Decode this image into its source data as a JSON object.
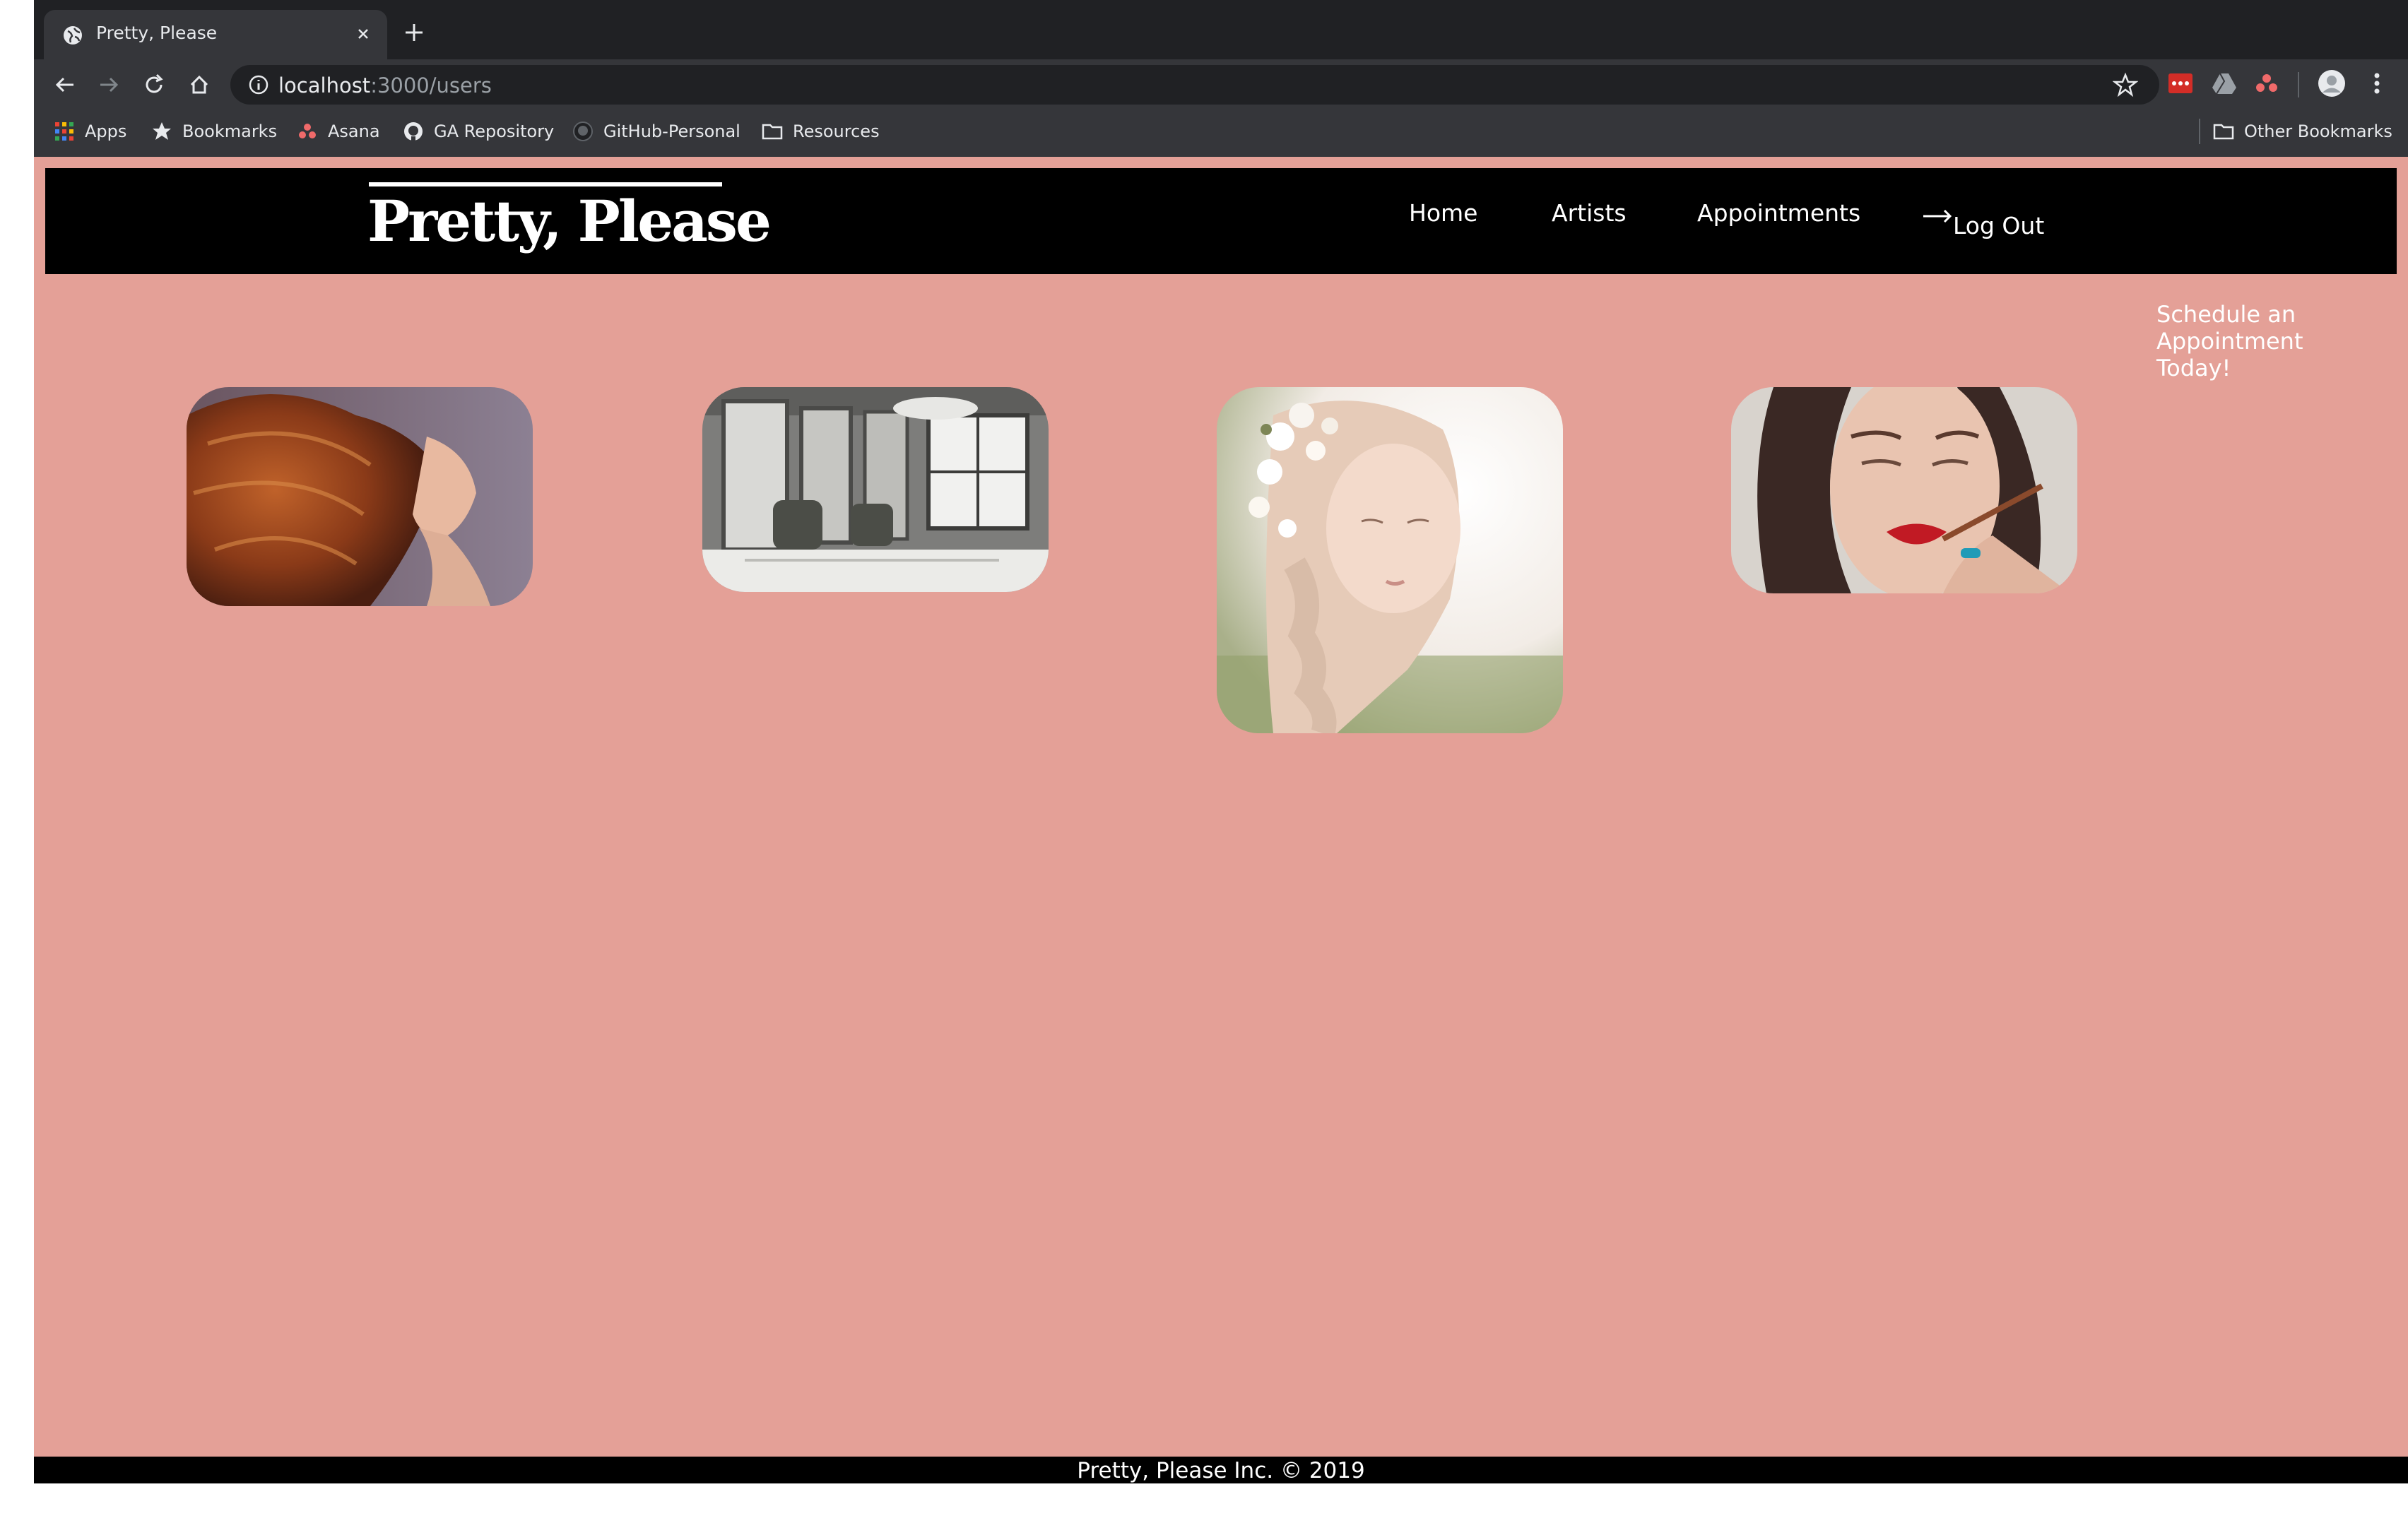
{
  "browser": {
    "tab_title": "Pretty, Please",
    "url_host": "localhost",
    "url_path": ":3000/users",
    "bookmarks": [
      "Apps",
      "Bookmarks",
      "Asana",
      "GA Repository",
      "GitHub-Personal",
      "Resources"
    ],
    "other_bookmarks": "Other Bookmarks"
  },
  "site": {
    "brand": "Pretty, Please",
    "nav": {
      "home": "Home",
      "artists": "Artists",
      "appointments": "Appointments",
      "logout": "Log Out"
    },
    "cta": "Schedule an Appointment Today!",
    "gallery": [
      {
        "name": "red-hair-woman-photo",
        "icon": "woman-flowing-red-hair"
      },
      {
        "name": "salon-interior-photo",
        "icon": "salon-chairs-mirrors-chandelier"
      },
      {
        "name": "flower-braid-photo",
        "icon": "blonde-braid-with-flowers"
      },
      {
        "name": "makeup-photo",
        "icon": "woman-lipstick-application"
      }
    ],
    "footer": "Pretty, Please Inc. © 2019"
  },
  "colors": {
    "page_background": "#e4a097",
    "navbar": "#000000",
    "text": "#ffffff"
  }
}
